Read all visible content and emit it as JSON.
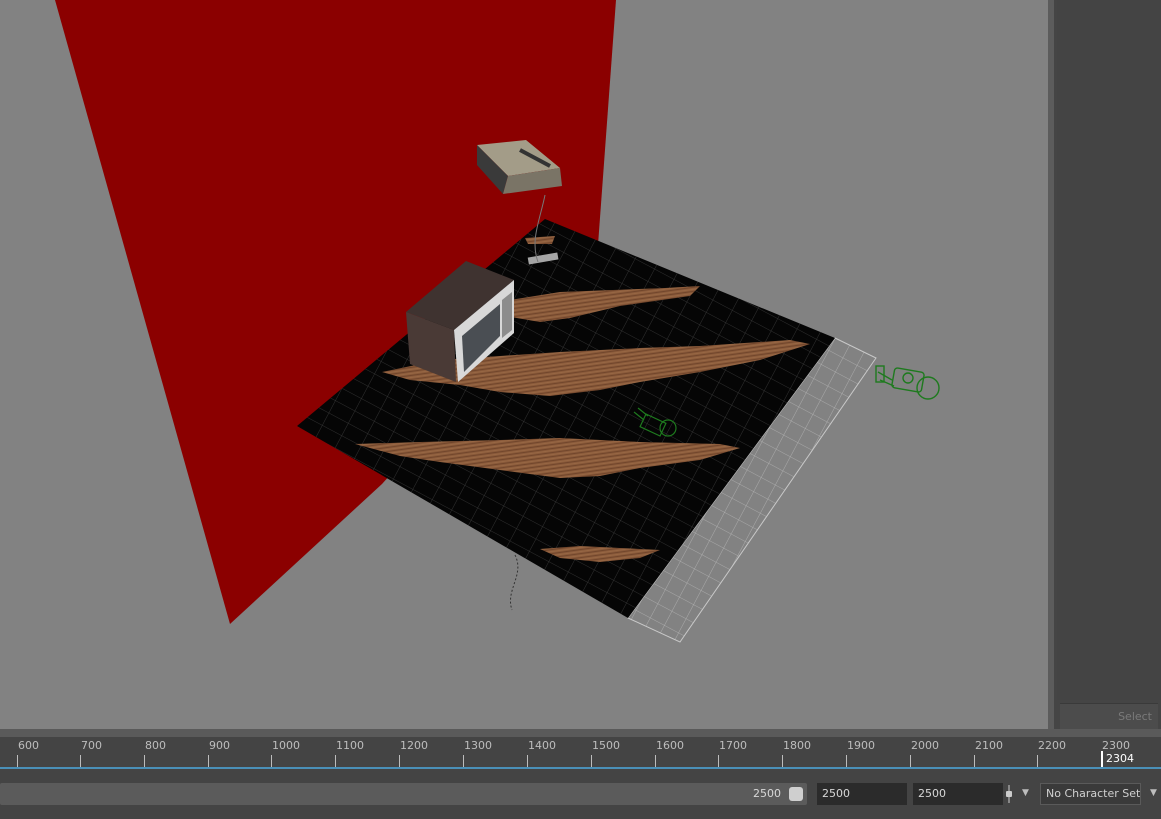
{
  "viewport": {
    "objects": [
      "red-backdrop",
      "floor-grid",
      "wood-planks",
      "crt-tv",
      "game-console",
      "camera-near",
      "camera-far",
      "console-cable"
    ]
  },
  "right_panel": {
    "select_label": "Select"
  },
  "time_slider": {
    "tick_labels": [
      "600",
      "700",
      "800",
      "900",
      "1000",
      "1100",
      "1200",
      "1300",
      "1400",
      "1500",
      "1600",
      "1700",
      "1800",
      "1900",
      "2000",
      "2100",
      "2200",
      "2300"
    ],
    "current_frame": "2304"
  },
  "range_bar": {
    "range_slider_value": "2500",
    "start_value": "2500",
    "end_value": "2500",
    "character_set": "No Character Set"
  },
  "colors": {
    "viewport_bg": "#828282",
    "backdrop": "#8b0000",
    "floor": "#000000",
    "wood": "#8a5a3a",
    "wireframe_camera": "#1e7a1e",
    "timeline_accent": "#4a90b8"
  }
}
